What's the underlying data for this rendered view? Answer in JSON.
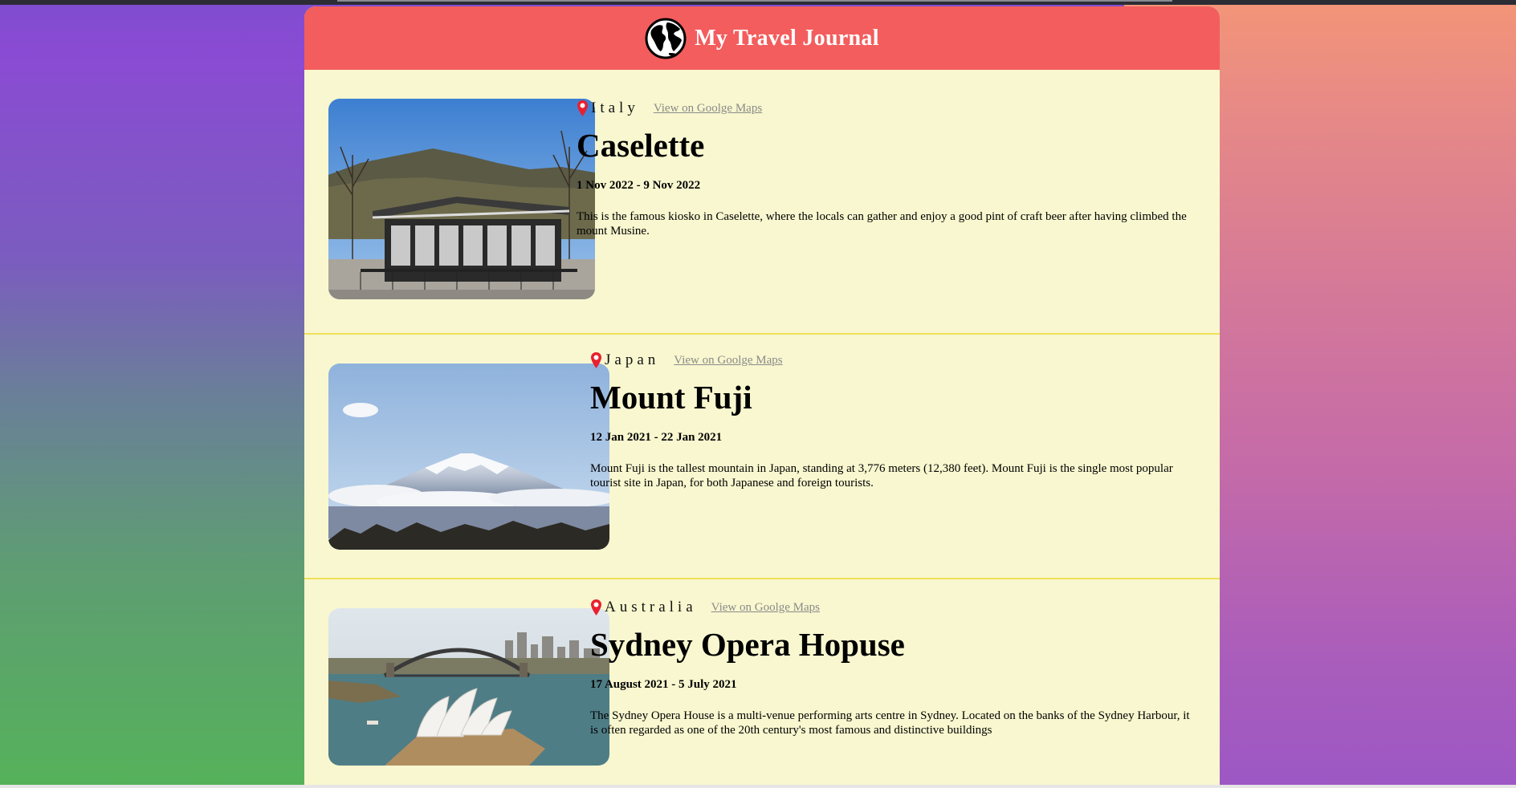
{
  "app": {
    "title": "My Travel Journal",
    "icon": "globe-icon",
    "header_color": "#f35d5d",
    "page_bg": "#f8f7cf",
    "divider_color": "#efe15a",
    "pin_color": "#e8202f"
  },
  "entries": [
    {
      "country": "Italy",
      "map_link": "View on Goolge Maps",
      "place": "Caselette",
      "dates": "1 Nov 2022 - 9 Nov 2022",
      "description": "This is the famous kiosko in Caselette, where the locals can gather and enjoy a good pint of craft beer after having climbed the mount Musine."
    },
    {
      "country": "Japan",
      "map_link": "View on Goolge Maps",
      "place": "Mount Fuji",
      "dates": "12 Jan 2021 - 22 Jan 2021",
      "description": "Mount Fuji is the tallest mountain in Japan, standing at 3,776 meters (12,380 feet). Mount Fuji is the single most popular tourist site in Japan, for both Japanese and foreign tourists."
    },
    {
      "country": "Australia",
      "map_link": "View on Goolge Maps",
      "place": "Sydney Opera Hopuse",
      "dates": "17 August 2021 - 5 July 2021",
      "description": "The Sydney Opera House is a multi-venue performing arts centre in Sydney. Located on the banks of the Sydney Harbour, it is often regarded as one of the 20th century's most famous and distinctive buildings"
    }
  ]
}
